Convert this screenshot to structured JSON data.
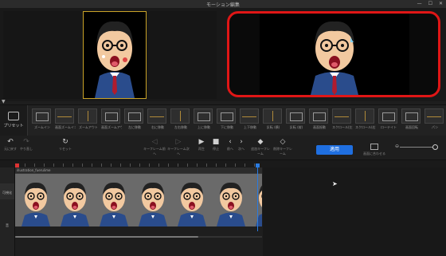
{
  "window": {
    "title": "モーション編集",
    "controls": [
      "—",
      "☐",
      "✕"
    ]
  },
  "preview": {
    "frame_color": "#c9a227",
    "highlight_color": "#e01616"
  },
  "panel_toggle": "▼",
  "presets": {
    "side_label": "プリセット",
    "items": [
      {
        "label": "ズームイン"
      },
      {
        "label": "画面ズームイン"
      },
      {
        "label": "ズームアウト"
      },
      {
        "label": "画面ズームアウト"
      },
      {
        "label": "左に移動"
      },
      {
        "label": "右に移動"
      },
      {
        "label": "左右移動"
      },
      {
        "label": "上に移動"
      },
      {
        "label": "下に移動"
      },
      {
        "label": "上下移動"
      },
      {
        "label": "反転 (横)"
      },
      {
        "label": "反転 (縦)"
      },
      {
        "label": "画面振動"
      },
      {
        "label": "スクロール(左)"
      },
      {
        "label": "スクロール(右)"
      },
      {
        "label": "ローテイト"
      },
      {
        "label": "画面回転"
      },
      {
        "label": "パン"
      }
    ]
  },
  "toolbar": {
    "undo": "元に戻す",
    "redo": "やり直し",
    "reset": "リセット",
    "kf_prev": "キーフレーム前へ",
    "kf_next": "キーフレーム次へ",
    "play": "再生",
    "stop": "停止",
    "prev": "前へ",
    "next": "次へ",
    "add_kf": "追加キーフレーム",
    "del_kf": "削除キーフレーム",
    "apply": "適用",
    "fit": "画面に合わせる"
  },
  "timeline": {
    "track_label": "illustration_fuerulime",
    "sidebar_label": "可視化",
    "sidebar_label2": "音",
    "playhead_color": "#2a7be0"
  }
}
